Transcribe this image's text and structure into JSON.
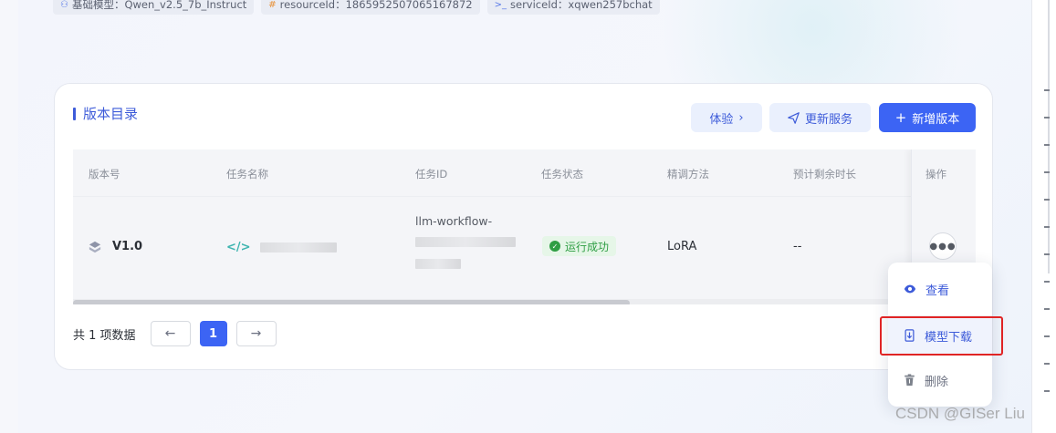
{
  "tags": [
    {
      "icon": "model-icon",
      "label": "基础模型：Qwen_v2.5_7b_Instruct"
    },
    {
      "icon": "hash-icon",
      "label": "resourceId：1865952507065167872"
    },
    {
      "icon": "terminal-icon",
      "label": "serviceId：xqwen257bchat"
    }
  ],
  "card": {
    "title": "版本目录",
    "buttons": {
      "try": "体验",
      "update": "更新服务",
      "new_version": "新增版本"
    }
  },
  "table": {
    "columns": [
      "版本号",
      "任务名称",
      "任务ID",
      "任务状态",
      "精调方法",
      "预计剩余时长",
      "操作"
    ],
    "rows": [
      {
        "version": "V1.0",
        "task_name": "",
        "task_id_line1": "llm-workflow-",
        "status": "运行成功",
        "method": "LoRA",
        "remaining": "--"
      }
    ]
  },
  "pagination": {
    "summary": "共 1 项数据",
    "current_page": "1"
  },
  "menu": {
    "items": [
      "查看",
      "模型下载",
      "删除"
    ]
  },
  "watermark": "CSDN @GISer Liu",
  "colors": {
    "primary": "#3c64f4",
    "success": "#2f9e44",
    "highlight": "#e02424"
  }
}
